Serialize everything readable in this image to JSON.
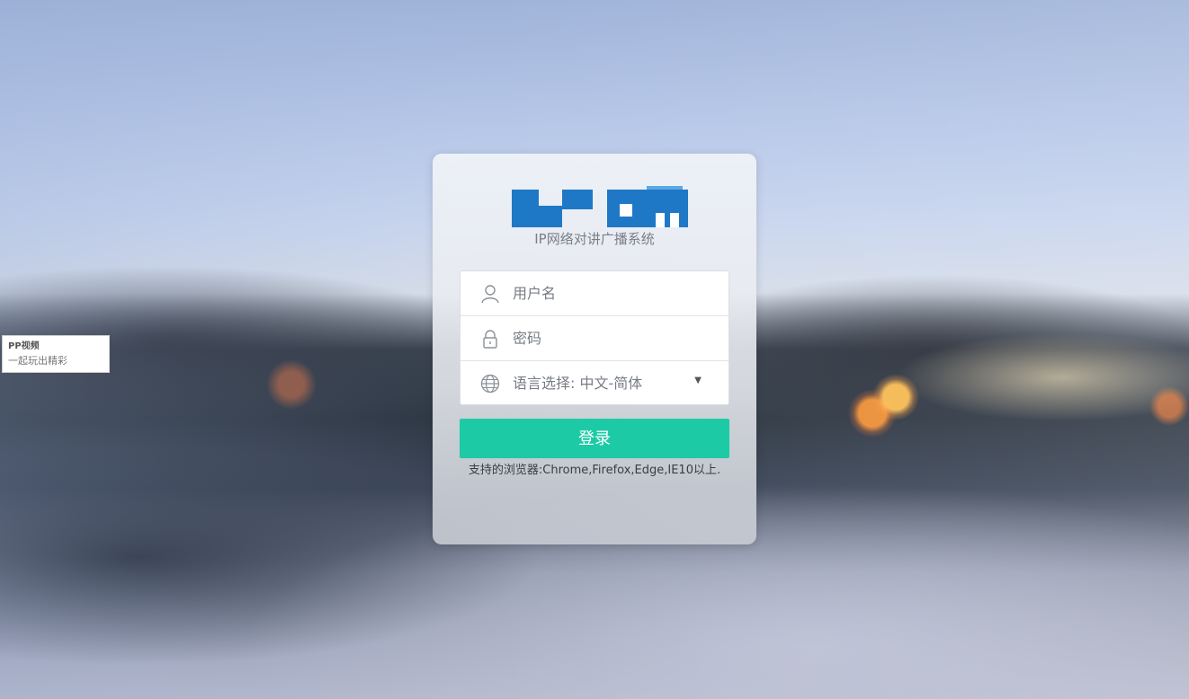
{
  "tooltip": {
    "title": "PP视频",
    "subtitle": "一起玩出精彩"
  },
  "login": {
    "subtitle": "IP网络对讲广播系统",
    "username_placeholder": "用户名",
    "password_placeholder": "密码",
    "language_label": "语言选择: 中文-简体",
    "login_button": "登录",
    "browser_note": "支持的浏览器:Chrome,Firefox,Edge,IE10以上."
  },
  "colors": {
    "accent": "#1dcaa6",
    "logo_blue": "#1f78c6"
  },
  "icons": {
    "username": "user-icon",
    "password": "lock-icon",
    "language": "globe-icon",
    "dropdown": "caret-down-icon"
  }
}
